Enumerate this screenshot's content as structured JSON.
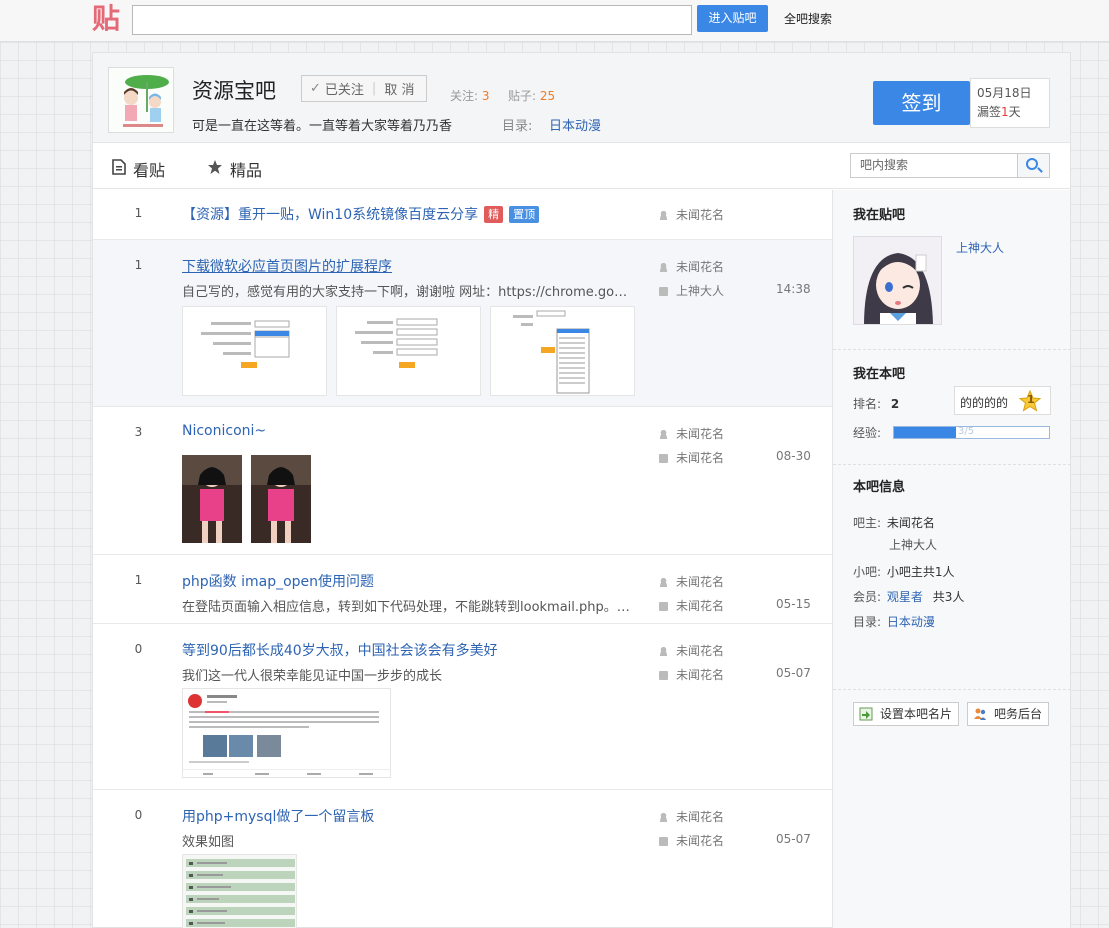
{
  "topbar": {
    "logo": "贴",
    "search_placeholder": "",
    "enter_label": "进入贴吧",
    "all_search_label": "全吧搜索"
  },
  "forum": {
    "name": "资源宝吧",
    "followed_label": "已关注",
    "cancel_label": "取 消",
    "follow_count_label": "关注:",
    "follow_count": "3",
    "post_count_label": "贴子:",
    "post_count": "25",
    "slogan": "可是一直在这等着。一直等着大家等着乃乃香",
    "directory_label": "目录:",
    "directory_value": "日本动漫",
    "sign_label": "签到",
    "sign_date": "05月18日",
    "missed_prefix": "漏签",
    "missed_days": "1",
    "missed_suffix": "天"
  },
  "nav": {
    "tabs": [
      {
        "label": "看贴",
        "icon": "document-icon"
      },
      {
        "label": "精品",
        "icon": "star-icon"
      }
    ],
    "search_placeholder": "吧内搜索"
  },
  "threads": [
    {
      "replies": "1",
      "title": "【资源】重开一贴，Win10系统镜像百度云分享",
      "badges": [
        {
          "text": "精",
          "color": "#e25b5b"
        },
        {
          "text": "置顶",
          "color": "#4a90e2"
        }
      ],
      "author": "未闻花名"
    },
    {
      "replies": "1",
      "title": "下载微软必应首页图片的扩展程序",
      "abstract": "自己写的，感觉有用的大家支持一下啊，谢谢啦 网址：https://chrome.google.co...",
      "author": "未闻花名",
      "last_reply": "上神大人",
      "time": "14:38"
    },
    {
      "replies": "3",
      "title": "Niconiconi~",
      "author": "未闻花名",
      "last_reply": "未闻花名",
      "time": "08-30"
    },
    {
      "replies": "1",
      "title": "php函数 imap_open使用问题",
      "abstract": "在登陆页面输入相应信息，转到如下代码处理，不能跳转到lookmail.php。怎样解...",
      "author": "未闻花名",
      "last_reply": "未闻花名",
      "time": "05-15"
    },
    {
      "replies": "0",
      "title": "等到90后都长成40岁大叔，中国社会该会有多美好",
      "abstract": "我们这一代人很荣幸能见证中国一步步的成长",
      "author": "未闻花名",
      "last_reply": "未闻花名",
      "time": "05-07"
    },
    {
      "replies": "0",
      "title": "用php+mysql做了一个留言板",
      "abstract": "效果如图",
      "author": "未闻花名",
      "last_reply": "未闻花名",
      "time": "05-07"
    }
  ],
  "sidebar": {
    "my_tieba_title": "我在贴吧",
    "username": "上神大人",
    "my_forum_title": "我在本吧",
    "rank_label": "排名:",
    "rank_value": "2",
    "level_name": "的的的的",
    "level_num": "1",
    "exp_label": "经验:",
    "exp_text": "3/5",
    "exp_progress": 0.4,
    "info_title": "本吧信息",
    "owner_label": "吧主:",
    "owners": [
      "未闻花名",
      "上神大人"
    ],
    "small_owner_label": "小吧:",
    "small_owner_value": "小吧主共1人",
    "member_label": "会员:",
    "member_name": "观星者",
    "member_count": "共3人",
    "dir_label": "目录:",
    "dir_value": "日本动漫",
    "btn_set_card": "设置本吧名片",
    "btn_admin": "吧务后台"
  },
  "colors": {
    "accent": "#3b87e6",
    "link": "#2d64b3",
    "count": "#f07b24"
  }
}
